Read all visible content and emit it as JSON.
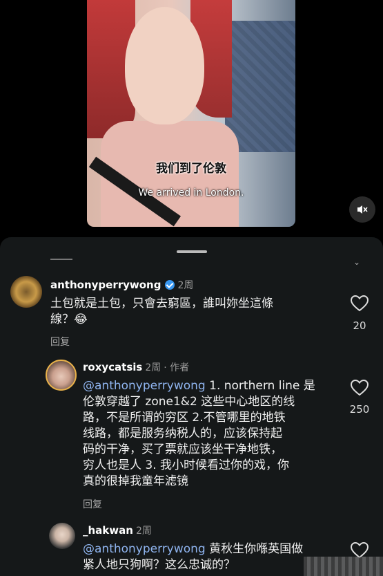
{
  "video": {
    "subtitle_cn": "我们到了伦敦",
    "subtitle_en": "We arrived in London."
  },
  "comments": [
    {
      "username": "anthonyperrywong",
      "verified": true,
      "time": "2周",
      "text": "土包就是土包，只會去窮區，誰叫妳坐這條線？😂",
      "line1": "土包就是土包，只會去窮區，誰叫妳坐這條",
      "line2": "線？😂",
      "reply_label": "回复",
      "likes": "20"
    },
    {
      "username": "roxycatsis",
      "time": "2周",
      "author_tag": "· 作者",
      "mention": "@anthonyperrywong",
      "lines": [
        " 1. northern line 是",
        "伦敦穿越了 zone1&2 这些中心地区的线",
        "路，不是所谓的穷区 2.不管哪里的地铁",
        "线路，都是服务纳税人的，应该保持起",
        "码的干净，买了票就应该坐干净地铁，",
        "穷人也是人 3. 我小时候看过你的戏，你",
        "真的很掉我童年滤镜"
      ],
      "reply_label": "回复",
      "likes": "250"
    },
    {
      "username": "_hakwan",
      "time": "2周",
      "mention": "@anthonyperrywong",
      "lines": [
        " 黄秋生你喺英国做",
        "紧人地只狗啊？这么忠诚的？"
      ]
    }
  ],
  "icons": {
    "mute": "speaker-muted-icon",
    "like": "heart-outline-icon",
    "verified": "verified-badge-icon"
  },
  "colors": {
    "mention": "#8fb4ef",
    "verified": "#3897f0",
    "sheet_bg": "#151819"
  }
}
